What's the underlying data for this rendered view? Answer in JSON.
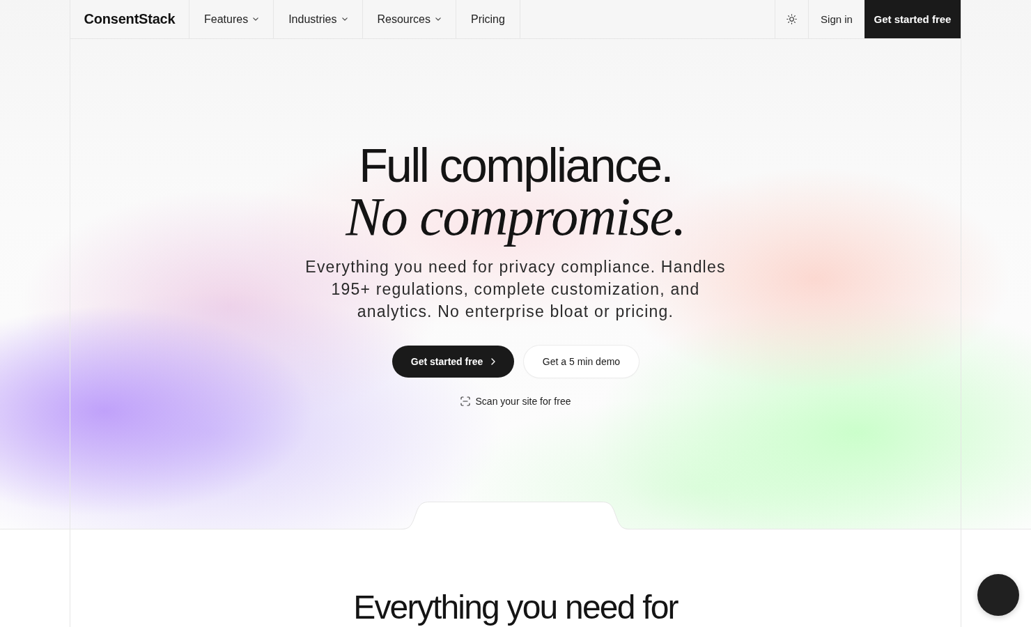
{
  "nav": {
    "logo": "ConsentStack",
    "items": [
      {
        "label": "Features",
        "dropdown": true
      },
      {
        "label": "Industries",
        "dropdown": true
      },
      {
        "label": "Resources",
        "dropdown": true
      },
      {
        "label": "Pricing",
        "dropdown": false
      }
    ],
    "sign_in": "Sign in",
    "cta": "Get started free"
  },
  "hero": {
    "title": "Full compliance.",
    "title_italic": "No compromise.",
    "subtitle": "Everything you need for privacy compliance. Handles 195+ regulations, complete customization, and analytics. No enterprise bloat or pricing.",
    "primary_button": "Get started free",
    "secondary_button": "Get a 5 min demo",
    "scan_link": "Scan your site for free"
  },
  "features": {
    "heading": "Everything you need for"
  }
}
